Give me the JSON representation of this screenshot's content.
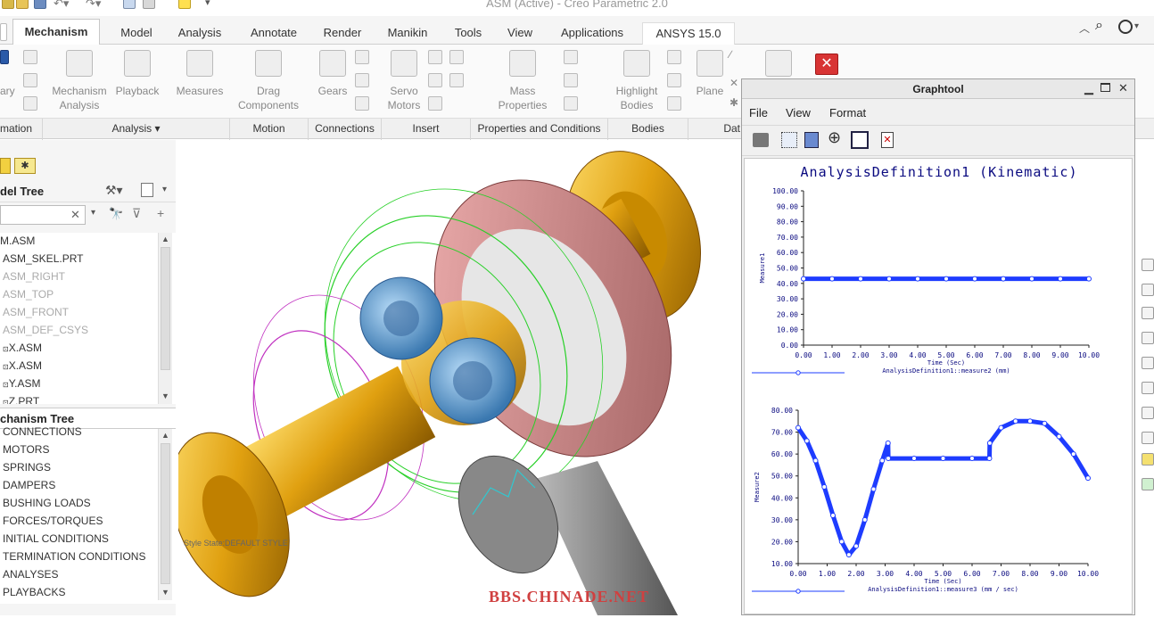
{
  "window": {
    "title": "ASM (Active) - Creo Parametric 2.0"
  },
  "tabs": [
    "Mechanism",
    "Model",
    "Analysis",
    "Annotate",
    "Render",
    "Manikin",
    "Tools",
    "View",
    "Applications",
    "ANSYS 15.0"
  ],
  "ribbon": {
    "left_partial": "ary",
    "mechanism_analysis": "Mechanism\nAnalysis",
    "playback": "Playback",
    "measures": "Measures",
    "drag_components": "Drag\nComponents",
    "gears": "Gears",
    "servo_motors": "Servo\nMotors",
    "mass_properties": "Mass\nProperties",
    "highlight_bodies": "Highlight\nBodies",
    "plane": "Plane"
  },
  "groups": [
    "mation",
    "Analysis ▾",
    "Motion",
    "Connections",
    "Insert",
    "Properties and Conditions",
    "Bodies",
    "Dat"
  ],
  "model_tree": {
    "header": "del Tree",
    "items": [
      {
        "label": "M.ASM",
        "dim": false
      },
      {
        "label": "ASM_SKEL.PRT",
        "dim": false
      },
      {
        "label": "ASM_RIGHT",
        "dim": true
      },
      {
        "label": "ASM_TOP",
        "dim": true
      },
      {
        "label": "ASM_FRONT",
        "dim": true
      },
      {
        "label": "ASM_DEF_CSYS",
        "dim": true
      },
      {
        "label": "X.ASM",
        "dim": false
      },
      {
        "label": "X.ASM",
        "dim": false
      },
      {
        "label": "Y.ASM",
        "dim": false
      },
      {
        "label": "Z.PRT",
        "dim": false
      }
    ]
  },
  "mechanism_tree": {
    "header": "chanism Tree",
    "items": [
      "CONNECTIONS",
      "MOTORS",
      "SPRINGS",
      "DAMPERS",
      "BUSHING LOADS",
      "FORCES/TORQUES",
      "INITIAL CONDITIONS",
      "TERMINATION CONDITIONS",
      "ANALYSES",
      "PLAYBACKS"
    ]
  },
  "viewport": {
    "style_state": "Style State:DEFAULT STYLE",
    "watermark": "BBS.CHINADE.NET"
  },
  "graphtool": {
    "title": "Graphtool",
    "menu": [
      "File",
      "View",
      "Format"
    ],
    "plot_title": "AnalysisDefinition1 (Kinematic)"
  },
  "chart_data": [
    {
      "type": "line",
      "title": "AnalysisDefinition1 (Kinematic)",
      "xlabel": "Time (Sec)",
      "ylabel": "Measure1",
      "legend": "AnalysisDefinition1::measure2 (mm)",
      "xlim": [
        0,
        10
      ],
      "ylim": [
        0,
        100
      ],
      "xticks": [
        "0.00",
        "1.00",
        "2.00",
        "3.00",
        "4.00",
        "5.00",
        "6.00",
        "7.00",
        "8.00",
        "9.00",
        "10.00"
      ],
      "yticks": [
        "100.00",
        "90.00",
        "80.00",
        "70.00",
        "60.00",
        "50.00",
        "40.00",
        "30.00",
        "20.00",
        "10.00",
        "0.00"
      ],
      "series_color": "#1e3cff",
      "x": [
        0,
        1,
        2,
        3,
        4,
        5,
        6,
        7,
        8,
        9,
        10
      ],
      "y": [
        43,
        43,
        43,
        43,
        43,
        43,
        43,
        43,
        43,
        43,
        43
      ]
    },
    {
      "type": "line",
      "xlabel": "Time (Sec)",
      "ylabel": "Measure2",
      "legend": "AnalysisDefinition1::measure3 (mm / sec)",
      "xlim": [
        0,
        10
      ],
      "ylim": [
        10,
        80
      ],
      "xticks": [
        "0.00",
        "1.00",
        "2.00",
        "3.00",
        "4.00",
        "5.00",
        "6.00",
        "7.00",
        "8.00",
        "9.00",
        "10.00"
      ],
      "yticks": [
        "80.00",
        "70.00",
        "60.00",
        "50.00",
        "40.00",
        "30.00",
        "20.00",
        "10.00"
      ],
      "series_color": "#1e3cff",
      "x": [
        0,
        0.3,
        0.6,
        0.9,
        1.2,
        1.5,
        1.75,
        2.0,
        2.3,
        2.6,
        2.9,
        3.1,
        3.11,
        4.0,
        5.0,
        6.0,
        6.6,
        6.61,
        7.0,
        7.5,
        8.0,
        8.5,
        9.0,
        9.5,
        10.0
      ],
      "y": [
        72,
        66,
        57,
        45,
        32,
        20,
        14,
        18,
        30,
        44,
        57,
        65,
        58,
        58,
        58,
        58,
        58,
        65,
        72,
        75,
        75,
        74,
        68,
        60,
        49
      ]
    }
  ]
}
